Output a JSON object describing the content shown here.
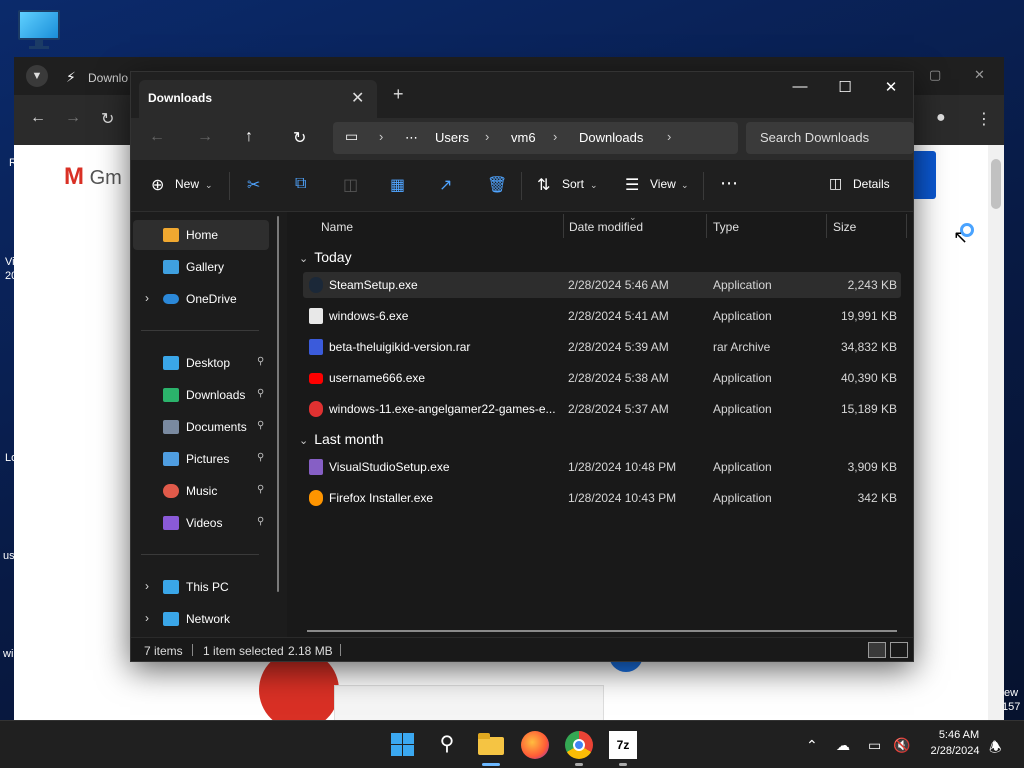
{
  "desktop": {
    "side_texts": [
      "R",
      "Vi",
      "20",
      "Lo",
      "us",
      "wi",
      "ew",
      "157"
    ]
  },
  "browser": {
    "tab_label": "Downlo",
    "gmail_label": "Gm"
  },
  "explorer": {
    "tab_title": "Downloads",
    "new_tab_symbol": "+",
    "breadcrumbs": [
      "Users",
      "vm6",
      "Downloads"
    ],
    "search_placeholder": "Search Downloads",
    "toolbar": {
      "new_label": "New",
      "sort_label": "Sort",
      "view_label": "View",
      "details_label": "Details"
    },
    "nav": {
      "top": [
        {
          "label": "Home",
          "active": true
        },
        {
          "label": "Gallery"
        },
        {
          "label": "OneDrive",
          "expandable": true
        }
      ],
      "quick": [
        {
          "label": "Desktop"
        },
        {
          "label": "Downloads"
        },
        {
          "label": "Documents"
        },
        {
          "label": "Pictures"
        },
        {
          "label": "Music"
        },
        {
          "label": "Videos"
        }
      ],
      "bottom": [
        {
          "label": "This PC"
        },
        {
          "label": "Network"
        }
      ]
    },
    "columns": [
      "Name",
      "Date modified",
      "Type",
      "Size"
    ],
    "groups": [
      {
        "label": "Today",
        "files": [
          {
            "name": "SteamSetup.exe",
            "date": "2/28/2024 5:46 AM",
            "type": "Application",
            "size": "2,243 KB",
            "selected": true,
            "icon": "steam-icon",
            "color": "#1b2838"
          },
          {
            "name": "windows-6.exe",
            "date": "2/28/2024 5:41 AM",
            "type": "Application",
            "size": "19,991 KB",
            "icon": "blank-file-icon",
            "color": "#e8e8e8"
          },
          {
            "name": "beta-theluigikid-version.rar",
            "date": "2/28/2024 5:39 AM",
            "type": "rar Archive",
            "size": "34,832 KB",
            "icon": "rar-icon",
            "color": "#3b5bdb"
          },
          {
            "name": "username666.exe",
            "date": "2/28/2024 5:38 AM",
            "type": "Application",
            "size": "40,390 KB",
            "icon": "youtube-icon",
            "color": "#ff0000"
          },
          {
            "name": "windows-11.exe-angelgamer22-games-e...",
            "date": "2/28/2024 5:37 AM",
            "type": "Application",
            "size": "15,189 KB",
            "icon": "red-app-icon",
            "color": "#e03131"
          }
        ]
      },
      {
        "label": "Last month",
        "files": [
          {
            "name": "VisualStudioSetup.exe",
            "date": "1/28/2024 10:48 PM",
            "type": "Application",
            "size": "3,909 KB",
            "icon": "visual-studio-icon",
            "color": "#865fc5"
          },
          {
            "name": "Firefox Installer.exe",
            "date": "1/28/2024 10:43 PM",
            "type": "Application",
            "size": "342 KB",
            "icon": "firefox-installer-icon",
            "color": "#ff9500"
          }
        ]
      }
    ],
    "status": {
      "items_count": "7 items",
      "selection": "1 item selected",
      "selection_size": "2.18 MB"
    }
  },
  "taskbar": {
    "time": "5:46 AM",
    "date": "2/28/2024"
  }
}
